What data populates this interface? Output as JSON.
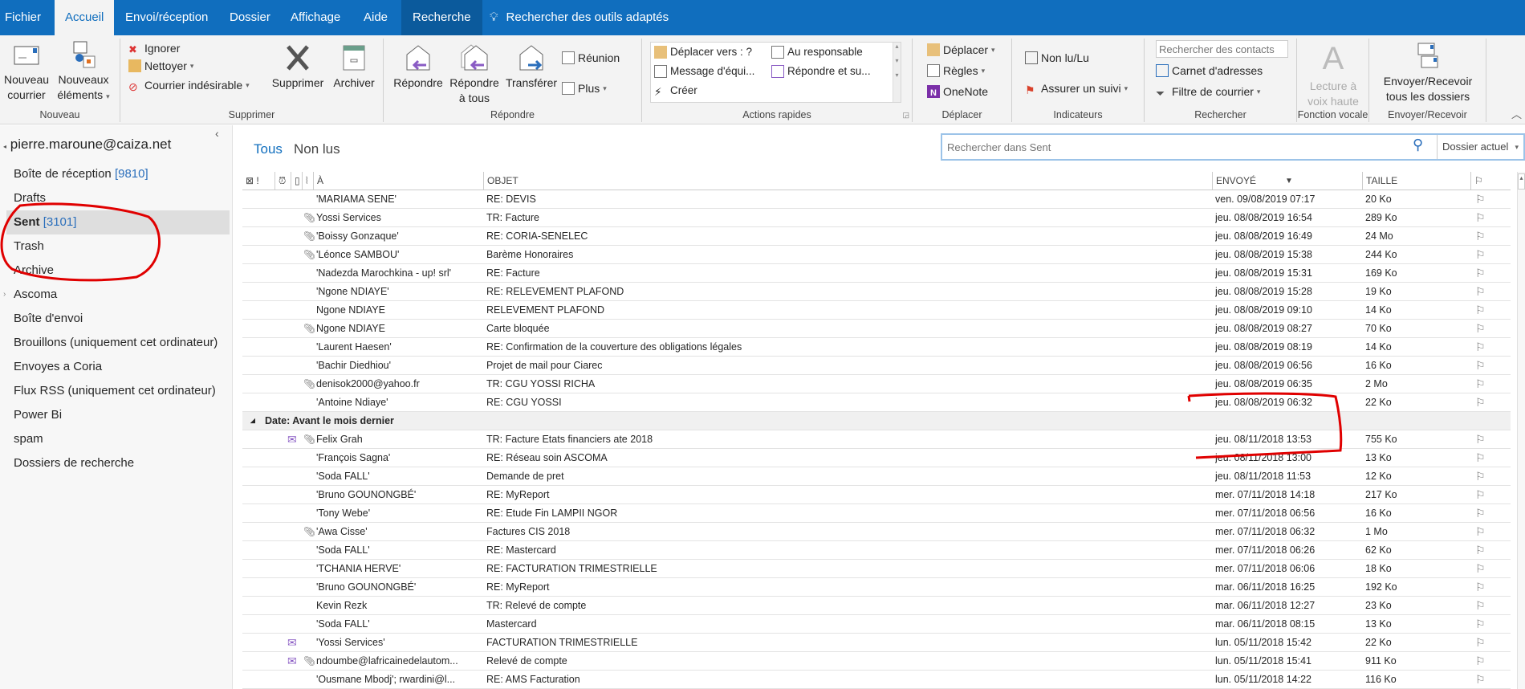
{
  "tabs": [
    "Fichier",
    "Accueil",
    "Envoi/réception",
    "Dossier",
    "Affichage",
    "Aide",
    "Recherche"
  ],
  "tell_me": "Rechercher des outils adaptés",
  "ribbon": {
    "nouveau": {
      "label": "Nouveau",
      "new_mail": [
        "Nouveau",
        "courrier"
      ],
      "new_items": [
        "Nouveaux",
        "éléments"
      ]
    },
    "supprimer": {
      "label": "Supprimer",
      "ignore": "Ignorer",
      "clean": "Nettoyer",
      "junk": "Courrier indésirable",
      "delete": "Supprimer",
      "archive": "Archiver"
    },
    "repondre": {
      "label": "Répondre",
      "reply": "Répondre",
      "reply_all": [
        "Répondre",
        "à tous"
      ],
      "forward": "Transférer",
      "meeting": "Réunion",
      "more": "Plus"
    },
    "quick_steps": {
      "label": "Actions rapides",
      "items": [
        "Déplacer vers : ?",
        "Au responsable",
        "Message d'équi...",
        "Répondre et su...",
        "Créer"
      ]
    },
    "deplacer": {
      "label": "Déplacer",
      "move": "Déplacer",
      "rules": "Règles",
      "onenote": "OneNote"
    },
    "indicateurs": {
      "label": "Indicateurs",
      "unread": "Non lu/Lu",
      "followup": "Assurer un suivi"
    },
    "rechercher": {
      "label": "Rechercher",
      "contacts_placeholder": "Rechercher des contacts",
      "address_book": "Carnet d'adresses",
      "filter": "Filtre de courrier"
    },
    "vocale": {
      "label": "Fonction vocale",
      "read_aloud": [
        "Lecture à",
        "voix haute"
      ]
    },
    "envoyer": {
      "label": "Envoyer/Recevoir",
      "send_all": [
        "Envoyer/Recevoir",
        "tous les dossiers"
      ]
    }
  },
  "sidebar": {
    "account": "pierre.maroune@caiza.net",
    "folders": [
      {
        "name": "Boîte de réception",
        "count": "[9810]"
      },
      {
        "name": "Drafts"
      },
      {
        "name": "Sent",
        "count": "[3101]",
        "selected": true
      },
      {
        "name": "Trash"
      },
      {
        "name": "Archive"
      },
      {
        "name": "Ascoma"
      },
      {
        "name": "Boîte d'envoi"
      },
      {
        "name": "Brouillons (uniquement cet ordinateur)"
      },
      {
        "name": "Envoyes a Coria"
      },
      {
        "name": "Flux RSS (uniquement cet ordinateur)"
      },
      {
        "name": "Power Bi"
      },
      {
        "name": "spam"
      },
      {
        "name": "Dossiers de recherche"
      }
    ]
  },
  "main": {
    "filters": [
      "Tous",
      "Non lus"
    ],
    "search_placeholder": "Rechercher dans Sent",
    "scope": "Dossier actuel",
    "columns": {
      "to": "À",
      "subject": "OBJET",
      "sent": "ENVOYÉ",
      "size": "TAILLE"
    },
    "group_header": "Date: Avant le mois dernier",
    "rows": [
      {
        "to": "'MARIAMA SENE'",
        "subject": "RE: DEVIS",
        "sent": "ven. 09/08/2019 07:17",
        "size": "20 Ko"
      },
      {
        "to": "Yossi Services",
        "subject": "TR: Facture",
        "sent": "jeu. 08/08/2019 16:54",
        "size": "289 Ko",
        "attach": true
      },
      {
        "to": "'Boissy Gonzaque'",
        "subject": "RE: CORIA-SENELEC",
        "sent": "jeu. 08/08/2019 16:49",
        "size": "24 Mo",
        "attach": true
      },
      {
        "to": "'Léonce SAMBOU'",
        "subject": "Barème Honoraires",
        "sent": "jeu. 08/08/2019 15:38",
        "size": "244 Ko",
        "attach": true
      },
      {
        "to": "'Nadezda Marochkina - up! srl'",
        "subject": "RE: Facture",
        "sent": "jeu. 08/08/2019 15:31",
        "size": "169 Ko"
      },
      {
        "to": "'Ngone NDIAYE'",
        "subject": "RE: RELEVEMENT PLAFOND",
        "sent": "jeu. 08/08/2019 15:28",
        "size": "19 Ko"
      },
      {
        "to": "Ngone NDIAYE",
        "subject": "RELEVEMENT PLAFOND",
        "sent": "jeu. 08/08/2019 09:10",
        "size": "14 Ko"
      },
      {
        "to": "Ngone NDIAYE",
        "subject": "Carte bloquée",
        "sent": "jeu. 08/08/2019 08:27",
        "size": "70 Ko",
        "attach": true
      },
      {
        "to": "'Laurent Haesen'",
        "subject": "RE: Confirmation de la couverture des obligations légales",
        "sent": "jeu. 08/08/2019 08:19",
        "size": "14 Ko"
      },
      {
        "to": "'Bachir Diedhiou'",
        "subject": "Projet de mail pour Ciarec",
        "sent": "jeu. 08/08/2019 06:56",
        "size": "16 Ko"
      },
      {
        "to": "denisok2000@yahoo.fr",
        "subject": "TR: CGU YOSSI RICHA",
        "sent": "jeu. 08/08/2019 06:35",
        "size": "2 Mo",
        "attach": true
      },
      {
        "to": "'Antoine Ndiaye'",
        "subject": "RE: CGU YOSSI",
        "sent": "jeu. 08/08/2019 06:32",
        "size": "22 Ko"
      }
    ],
    "rows_older": [
      {
        "to": "Felix Grah",
        "subject": "TR: Facture Etats financiers ate 2018",
        "sent": "jeu. 08/11/2018 13:53",
        "size": "755 Ko",
        "attach": true,
        "replied": true
      },
      {
        "to": "'François Sagna'",
        "subject": "RE: Réseau soin ASCOMA",
        "sent": "jeu. 08/11/2018 13:00",
        "size": "13 Ko"
      },
      {
        "to": "'Soda FALL'",
        "subject": "Demande de pret",
        "sent": "jeu. 08/11/2018 11:53",
        "size": "12 Ko"
      },
      {
        "to": "'Bruno GOUNONGBÉ'",
        "subject": "RE: MyReport",
        "sent": "mer. 07/11/2018 14:18",
        "size": "217 Ko"
      },
      {
        "to": "'Tony Webe'",
        "subject": "RE: Etude Fin  LAMPII NGOR",
        "sent": "mer. 07/11/2018 06:56",
        "size": "16 Ko"
      },
      {
        "to": "'Awa Cisse'",
        "subject": "Factures CIS 2018",
        "sent": "mer. 07/11/2018 06:32",
        "size": "1 Mo",
        "attach": true
      },
      {
        "to": "'Soda FALL'",
        "subject": "RE: Mastercard",
        "sent": "mer. 07/11/2018 06:26",
        "size": "62 Ko"
      },
      {
        "to": "'TCHANIA HERVE'",
        "subject": "RE: FACTURATION TRIMESTRIELLE",
        "sent": "mer. 07/11/2018 06:06",
        "size": "18 Ko"
      },
      {
        "to": "'Bruno GOUNONGBÉ'",
        "subject": "RE: MyReport",
        "sent": "mar. 06/11/2018 16:25",
        "size": "192 Ko"
      },
      {
        "to": "Kevin Rezk",
        "subject": "TR: Relevé de compte",
        "sent": "mar. 06/11/2018 12:27",
        "size": "23 Ko"
      },
      {
        "to": "'Soda FALL'",
        "subject": "Mastercard",
        "sent": "mar. 06/11/2018 08:15",
        "size": "13 Ko"
      },
      {
        "to": "'Yossi Services'",
        "subject": "FACTURATION TRIMESTRIELLE",
        "sent": "lun. 05/11/2018 15:42",
        "size": "22 Ko",
        "replied": true
      },
      {
        "to": "ndoumbe@lafricainedelautom...",
        "subject": "Relevé de compte",
        "sent": "lun. 05/11/2018 15:41",
        "size": "911 Ko",
        "attach": true,
        "replied": true
      },
      {
        "to": "'Ousmane Mbodj'; rwardini@l...",
        "subject": "RE: AMS  Facturation",
        "sent": "lun. 05/11/2018 14:22",
        "size": "116 Ko"
      }
    ]
  },
  "colors": {
    "accent": "#106ebe",
    "count": "#2a6ebb",
    "annotation": "#e00000"
  }
}
